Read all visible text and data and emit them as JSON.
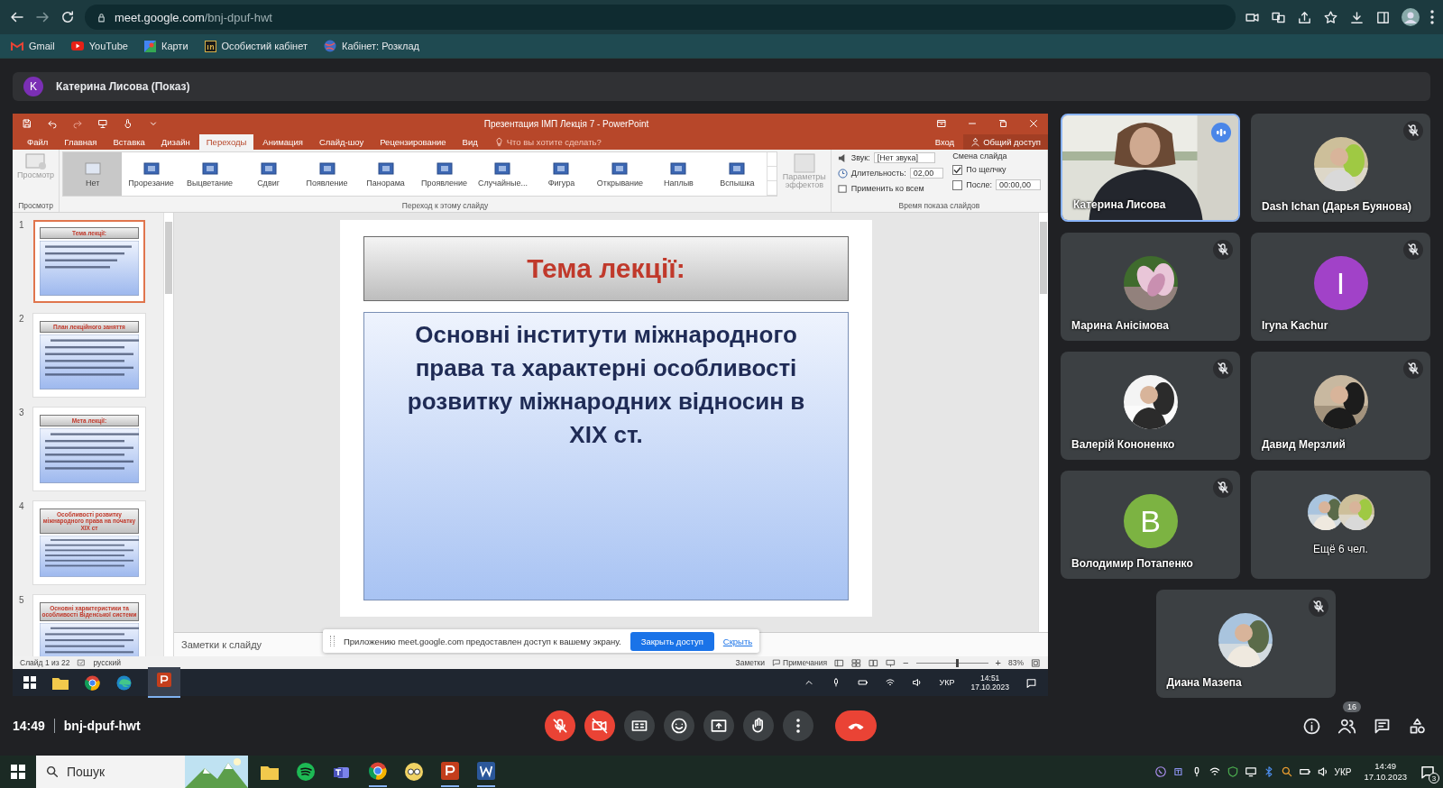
{
  "browser": {
    "url_host": "meet.google.com",
    "url_path": "/bnj-dpuf-hwt",
    "bookmarks": [
      {
        "label": "Gmail",
        "kind": "mail"
      },
      {
        "label": "YouTube",
        "kind": "play"
      },
      {
        "label": "Карти",
        "kind": "map"
      },
      {
        "label": "Особистий кабінет",
        "kind": "square"
      },
      {
        "label": "Кабінет: Розклад",
        "kind": "globe"
      }
    ]
  },
  "presenter": {
    "initial": "K",
    "name": "Катерина Лисова (Показ)"
  },
  "powerpoint": {
    "title": "Презентация ІМП Лекція 7 - PowerPoint",
    "tabs": [
      {
        "label": "Файл",
        "selected": false
      },
      {
        "label": "Главная",
        "selected": false
      },
      {
        "label": "Вставка",
        "selected": false
      },
      {
        "label": "Дизайн",
        "selected": false
      },
      {
        "label": "Переходы",
        "selected": true
      },
      {
        "label": "Анимация",
        "selected": false
      },
      {
        "label": "Слайд-шоу",
        "selected": false
      },
      {
        "label": "Рецензирование",
        "selected": false
      },
      {
        "label": "Вид",
        "selected": false
      }
    ],
    "tell_me": "Что вы хотите сделать?",
    "sign_in": "Вход",
    "share": "Общий доступ",
    "preview": "Просмотр",
    "transitions": [
      {
        "label": "Нет",
        "selected": true
      },
      {
        "label": "Прорезание",
        "selected": false
      },
      {
        "label": "Выцветание",
        "selected": false
      },
      {
        "label": "Сдвиг",
        "selected": false
      },
      {
        "label": "Появление",
        "selected": false
      },
      {
        "label": "Панорама",
        "selected": false
      },
      {
        "label": "Проявление",
        "selected": false
      },
      {
        "label": "Случайные...",
        "selected": false
      },
      {
        "label": "Фигура",
        "selected": false
      },
      {
        "label": "Открывание",
        "selected": false
      },
      {
        "label": "Наплыв",
        "selected": false
      },
      {
        "label": "Вспышка",
        "selected": false
      }
    ],
    "effect_options": [
      "Параметры",
      "эффектов"
    ],
    "sound_label": "Звук:",
    "sound_value": "[Нет звука]",
    "duration_label": "Длительность:",
    "duration_value": "02,00",
    "apply_all": "Применить ко всем",
    "advance_title": "Смена слайда",
    "on_click": {
      "label": "По щелчку",
      "checked": true
    },
    "after": {
      "label": "После:",
      "checked": false,
      "value": "00:00,00"
    },
    "groups": [
      "Просмотр",
      "Переход к этому слайду",
      "Время показа слайдов"
    ],
    "thumbnails": [
      {
        "number": "1",
        "title": "Тема лекції:",
        "selected": true
      },
      {
        "number": "2",
        "title": "План лекційного заняття",
        "selected": false
      },
      {
        "number": "3",
        "title": "Мета лекції:",
        "selected": false
      },
      {
        "number": "4",
        "title": "Особливості розвитку міжнародного права на початку XIX ст",
        "selected": false
      },
      {
        "number": "5",
        "title": "Основні характеристики та особливості Віденської системи",
        "selected": false
      }
    ],
    "slide": {
      "title": "Тема лекції:",
      "body": "Основні інститути міжнародного права та характерні особливості розвитку міжнародних відносин в XIX ст."
    },
    "notes_placeholder": "Заметки к слайду",
    "share_notice": {
      "text": "Приложению meet.google.com предоставлен доступ к вашему экрану.",
      "stop": "Закрыть доступ",
      "hide": "Скрыть"
    },
    "status": {
      "slide": "Слайд 1 из 22",
      "language": "русский",
      "notes": "Заметки",
      "comments": "Примечания",
      "zoom": "83%",
      "zoom_out": "−",
      "zoom_in": "+",
      "level": 0.55
    },
    "taskbar": {
      "language": "УКР",
      "time": "14:51",
      "date": "17.10.2023"
    }
  },
  "participants": [
    {
      "name": "Катерина Лисова",
      "kind": "video",
      "muted": false,
      "speaking": true
    },
    {
      "name": "Dash Ichan (Дарья Буянова)",
      "muted": true,
      "speaking": false
    },
    {
      "name": "Марина Анісімова",
      "muted": true,
      "speaking": false
    },
    {
      "name": "Iryna Kachur",
      "kind": "initial",
      "initial": "I",
      "color": "#a142c8",
      "muted": true,
      "speaking": false
    },
    {
      "name": "Валерій Кононенко",
      "muted": true,
      "speaking": false
    },
    {
      "name": "Давид Мерзлий",
      "muted": true,
      "speaking": false
    },
    {
      "name": "Володимир Потапенко",
      "kind": "initial",
      "initial": "B",
      "color": "#7cb342",
      "muted": true,
      "speaking": false
    },
    {
      "name": "Ещё 6 чел.",
      "kind": "more",
      "muted": false,
      "speaking": false
    },
    {
      "name": "Диана Мазепа",
      "muted": true,
      "speaking": false
    }
  ],
  "meeting": {
    "time": "14:49",
    "code": "bnj-dpuf-hwt",
    "people_count": "16",
    "controls": [
      {
        "kind": "mic",
        "on": false
      },
      {
        "kind": "camera",
        "on": false
      },
      {
        "kind": "captions"
      },
      {
        "kind": "emoji"
      },
      {
        "kind": "present"
      },
      {
        "kind": "hand"
      },
      {
        "kind": "more"
      },
      {
        "kind": "end"
      }
    ]
  },
  "windows_taskbar": {
    "search": "Пошук",
    "language": "УКР",
    "time": "14:49",
    "date": "17.10.2023",
    "notifications": "3"
  }
}
